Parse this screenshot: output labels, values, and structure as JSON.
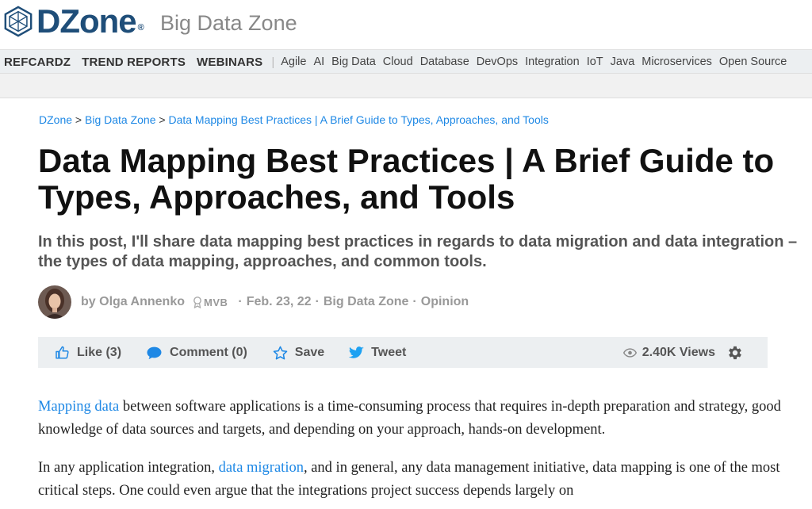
{
  "header": {
    "logo_text": "DZone",
    "logo_mark": "®",
    "zone_title": "Big Data Zone"
  },
  "nav": {
    "main_items": [
      "REFCARDZ",
      "TREND REPORTS",
      "WEBINARS"
    ],
    "separator": "|",
    "topics": [
      "Agile",
      "AI",
      "Big Data",
      "Cloud",
      "Database",
      "DevOps",
      "Integration",
      "IoT",
      "Java",
      "Microservices",
      "Open Source"
    ]
  },
  "breadcrumb": {
    "items": [
      "DZone",
      "Big Data Zone",
      "Data Mapping Best Practices | A Brief Guide to Types, Approaches, and Tools"
    ],
    "separator": ">"
  },
  "article": {
    "title": "Data Mapping Best Practices | A Brief Guide to Types, Approaches, and Tools",
    "subtitle": "In this post, I'll share data mapping best practices in regards to data migration and data integration – the types of data mapping, approaches, and common tools.",
    "byline": {
      "prefix": "by",
      "author": "Olga Annenko",
      "badge": "MVB",
      "dot": "·",
      "date": "Feb. 23, 22",
      "zone": "Big Data Zone",
      "type": "Opinion"
    }
  },
  "actions": {
    "like": "Like (3)",
    "comment": "Comment (0)",
    "save": "Save",
    "tweet": "Tweet",
    "views": "2.40K Views"
  },
  "body": {
    "p1_link": "Mapping data",
    "p1_text": " between software applications is a time-consuming process that requires in-depth preparation and strategy, good knowledge of data sources and targets, and depending on your approach, hands-on development.",
    "p2_before": "In any application integration, ",
    "p2_link": "data migration",
    "p2_after": ", and in general, any data management initiative, data mapping is one of the most critical steps. One could even argue that the integrations project success depends largely on"
  },
  "colors": {
    "link": "#1e88e5",
    "logo": "#1f4e79",
    "twitter": "#1da1f2"
  }
}
